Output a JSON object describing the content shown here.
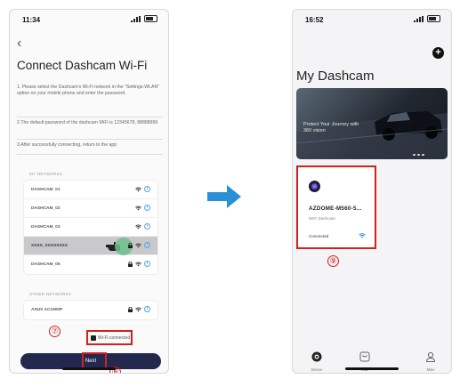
{
  "left_screen": {
    "status_time": "11:34",
    "title": "Connect Dashcam Wi-Fi",
    "instructions": [
      "1. Please select the Dashcam's Wi-Fi network in the \"Settings-WLAN\" option on your mobile phone and enter the password.",
      "2.The default password of the dashcam WiFi is 12345678, 88888999",
      "3.After successfully connecting, return to the app"
    ],
    "my_networks_label": "MY NETWORKS",
    "networks": [
      "DASHCAM_01",
      "DASHCAM_02",
      "DASHCAM_03",
      "XXXX_XXXXXXXX",
      "DASHCAM_05"
    ],
    "other_networks_label": "OTHER NETWORKS",
    "other_networks": [
      "ASUS AC1900P"
    ],
    "checkbox_label": "Wi-Fi connected",
    "next_button": "Next",
    "step_7": "⑦",
    "step_8": "⑧"
  },
  "right_screen": {
    "status_time": "16:52",
    "add_icon": "+",
    "title": "My Dashcam",
    "banner_text": "Protect Your Journey with 360 vision",
    "device": {
      "name": "AZDOME-M560-5...",
      "type": "WiFi Dashcam",
      "status": "Connected"
    },
    "step_9": "⑨",
    "tabs": [
      "Device",
      "Mall",
      "Mine"
    ]
  },
  "colors": {
    "highlight_red": "#d42020",
    "next_button": "#23284e",
    "arrow_blue": "#2b8fd6",
    "tap_green": "#6fbf8d"
  },
  "icons": [
    "back-icon",
    "wifi-icon",
    "lock-icon",
    "info-icon",
    "hand-pointer-icon",
    "arrow-right-icon",
    "add-icon",
    "car-icon",
    "tab-device-icon",
    "tab-mall-icon",
    "tab-mine-icon"
  ]
}
